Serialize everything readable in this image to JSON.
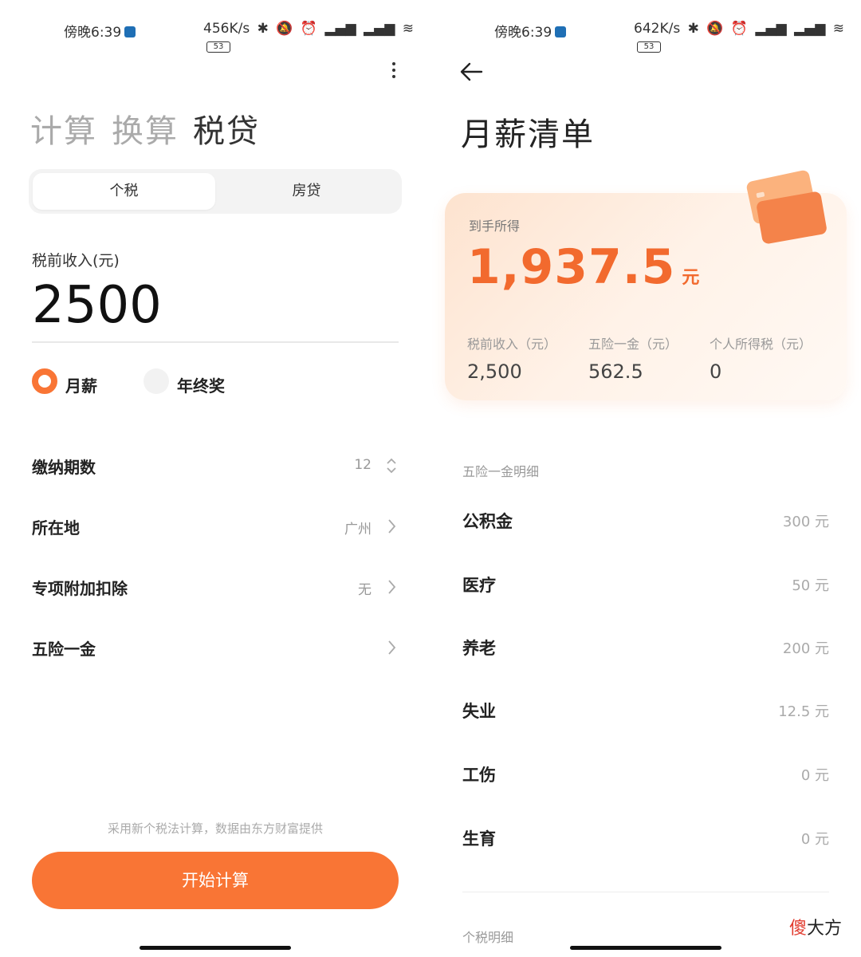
{
  "left": {
    "status": {
      "time": "傍晚6:39",
      "speed": "456K/s",
      "battery": "53"
    },
    "mode_tabs": [
      "计算",
      "换算",
      "税贷"
    ],
    "segments": [
      "个税",
      "房贷"
    ],
    "income_label": "税前收入(元)",
    "income_value": "2500",
    "radios": [
      {
        "label": "月薪",
        "selected": true
      },
      {
        "label": "年终奖",
        "selected": false
      }
    ],
    "rows": [
      {
        "label": "缴纳期数",
        "value": "12",
        "icon": "up-down-icon"
      },
      {
        "label": "所在地",
        "value": "广州",
        "icon": "chevron-right-icon"
      },
      {
        "label": "专项附加扣除",
        "value": "无",
        "icon": "chevron-right-icon"
      },
      {
        "label": "五险一金",
        "value": "",
        "icon": "chevron-right-icon"
      }
    ],
    "note": "采用新个税法计算，数据由东方财富提供",
    "start_button": "开始计算"
  },
  "right": {
    "status": {
      "time": "傍晚6:39",
      "speed": "642K/s",
      "battery": "53"
    },
    "title": "月薪清单",
    "card": {
      "net_label": "到手所得",
      "net_value": "1,937.5",
      "net_unit": "元",
      "stats": [
        {
          "label": "税前收入（元）",
          "value": "2,500"
        },
        {
          "label": "五险一金（元）",
          "value": "562.5"
        },
        {
          "label": "个人所得税（元）",
          "value": "0"
        }
      ]
    },
    "insurance_section": "五险一金明细",
    "insurance_items": [
      {
        "label": "公积金",
        "value": "300 元"
      },
      {
        "label": "医疗",
        "value": "50 元"
      },
      {
        "label": "养老",
        "value": "200 元"
      },
      {
        "label": "失业",
        "value": "12.5 元"
      },
      {
        "label": "工伤",
        "value": "0 元"
      },
      {
        "label": "生育",
        "value": "0 元"
      }
    ],
    "tax_section": "个税明细"
  },
  "watermark": {
    "red": "傻",
    "rest": "大方"
  },
  "colors": {
    "accent": "#f97535",
    "net_value": "#f26a2e",
    "watermark_red": "#e23b2e"
  }
}
